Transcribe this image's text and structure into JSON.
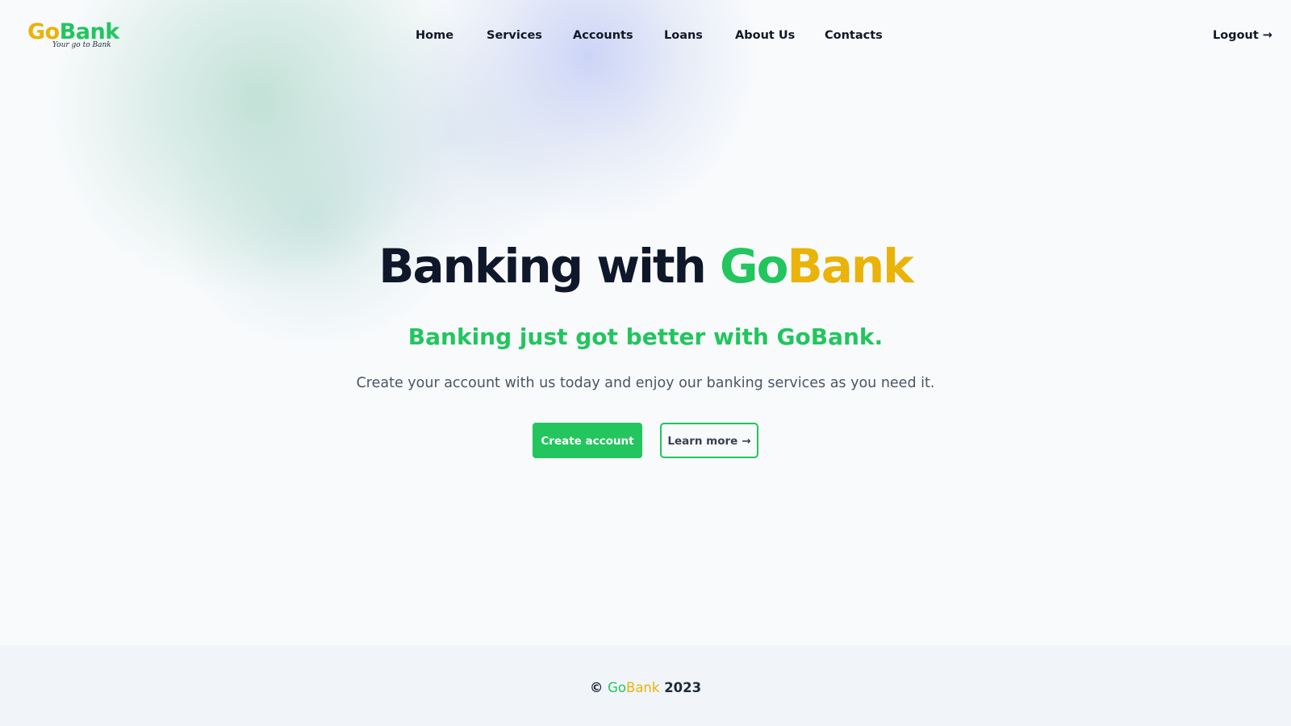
{
  "brand": {
    "logo_go": "Go",
    "logo_bank": "Bank",
    "tagline": "Your go to Bank",
    "colors": {
      "green": "#22c55e",
      "gold": "#eab308",
      "dark": "#0f172a"
    }
  },
  "nav": {
    "items": [
      {
        "label": "Home"
      },
      {
        "label": "Services"
      },
      {
        "label": "Accounts"
      },
      {
        "label": "Loans"
      },
      {
        "label": "About Us"
      },
      {
        "label": "Contacts"
      }
    ],
    "logout_label": "Logout",
    "logout_icon": "arrow-right-icon"
  },
  "hero": {
    "title_prefix": "Banking with",
    "title_go": "Go",
    "title_bank": "Bank",
    "subtitle": "Banking just got better with GoBank.",
    "description": "Create your account with us today and enjoy our banking services as you need it.",
    "primary_button": "Create account",
    "secondary_button": "Learn more",
    "secondary_icon": "arrow-right-icon"
  },
  "footer": {
    "copyright_symbol": "©",
    "brand_go": "Go",
    "brand_bank": "Bank",
    "year": "2023"
  }
}
